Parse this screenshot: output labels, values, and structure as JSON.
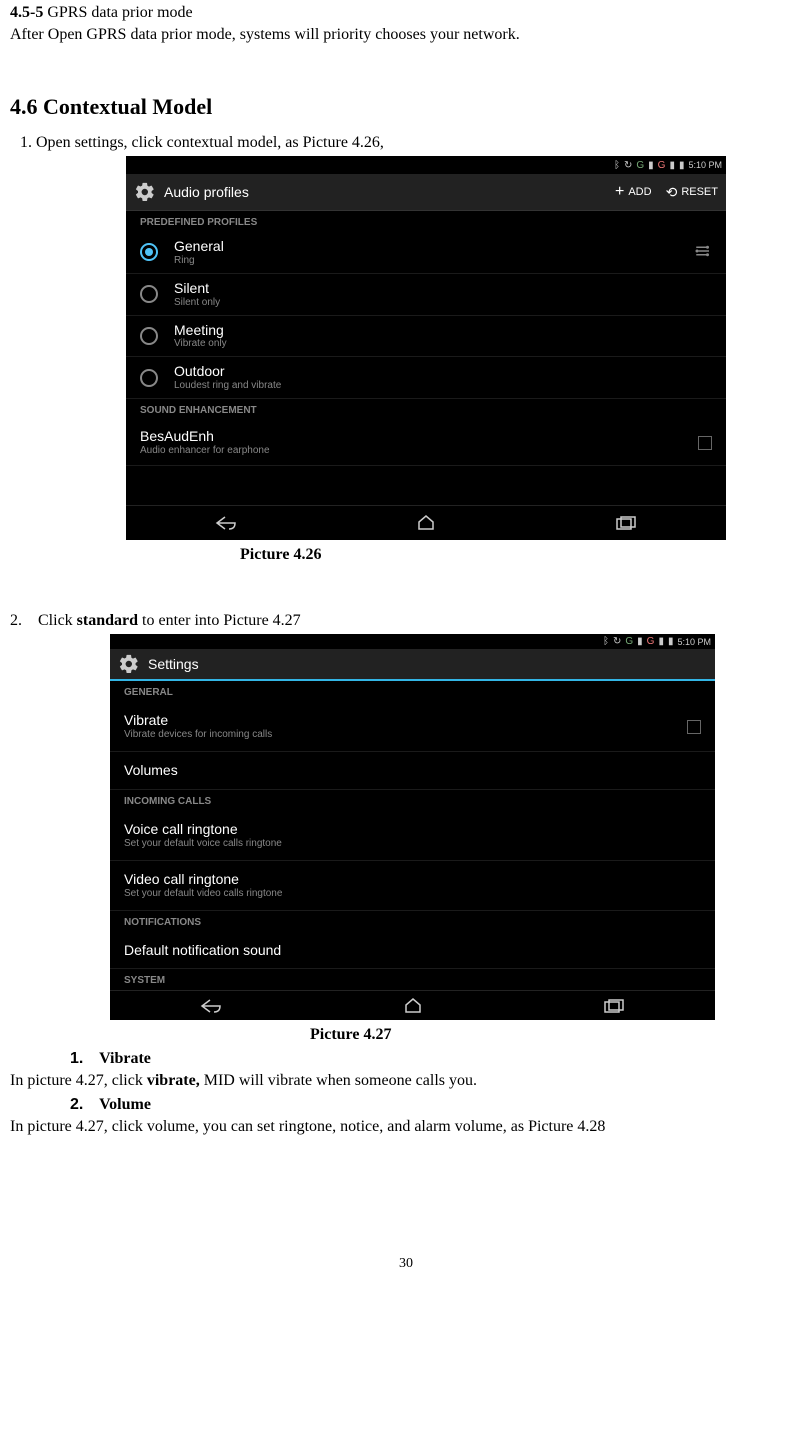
{
  "section45": {
    "heading_prefix": "4.5-5 ",
    "heading_text": "GPRS data prior mode",
    "body": "After Open GPRS data prior mode, systems will priority chooses your network."
  },
  "section46": {
    "heading": "4.6 Contextual Model",
    "step1": "1. Open settings, click contextual model, as Picture 4.26,",
    "caption1": "Picture 4.26",
    "step2_num": "2.",
    "step2_text_a": "Click ",
    "step2_bold": "standard",
    "step2_text_b": " to enter into Picture 4.27",
    "caption2": "Picture 4.27",
    "sub1_num": "1.",
    "sub1_label": "Vibrate",
    "sub1_body_a": "In picture 4.27, click ",
    "sub1_body_bold": "vibrate,",
    "sub1_body_b": " MID will vibrate when someone calls you.",
    "sub2_num": "2.",
    "sub2_label": "Volume",
    "sub2_body": "In picture 4.27, click volume, you can set ringtone, notice, and alarm volume, as Picture 4.28"
  },
  "shot1": {
    "time": "5:10 PM",
    "header_title": "Audio profiles",
    "add": "ADD",
    "reset": "RESET",
    "sec_predefined": "PREDEFINED PROFILES",
    "general": "General",
    "general_sub": "Ring",
    "silent": "Silent",
    "silent_sub": "Silent only",
    "meeting": "Meeting",
    "meeting_sub": "Vibrate only",
    "outdoor": "Outdoor",
    "outdoor_sub": "Loudest ring and vibrate",
    "sec_enh": "SOUND ENHANCEMENT",
    "besaudenh": "BesAudEnh",
    "besaudenh_sub": "Audio enhancer for earphone"
  },
  "shot2": {
    "time": "5:10 PM",
    "header_title": "Settings",
    "sec_general": "GENERAL",
    "vibrate": "Vibrate",
    "vibrate_sub": "Vibrate devices for incoming calls",
    "volumes": "Volumes",
    "sec_incoming": "INCOMING CALLS",
    "voice": "Voice call ringtone",
    "voice_sub": "Set your default voice calls ringtone",
    "video": "Video call ringtone",
    "video_sub": "Set your default video calls ringtone",
    "sec_notif": "NOTIFICATIONS",
    "default_notif": "Default notification sound",
    "sec_system": "SYSTEM"
  },
  "page_number": "30"
}
